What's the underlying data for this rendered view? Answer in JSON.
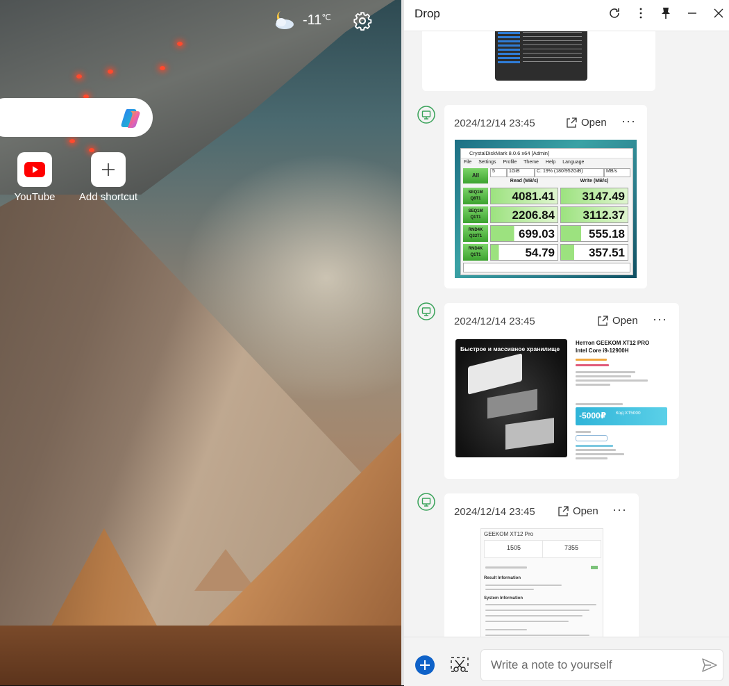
{
  "newtab": {
    "weather": {
      "temperature": "-11",
      "unit": "℃",
      "icon": "partly-cloudy-night-icon"
    },
    "settings_icon": "gear-icon",
    "search": {
      "placeholder": "",
      "copilot_icon": "copilot-icon"
    },
    "shortcuts": [
      {
        "label": "YouTube",
        "icon": "youtube-icon"
      },
      {
        "label": "Add shortcut",
        "icon": "plus-icon"
      }
    ]
  },
  "drop": {
    "title": "Drop",
    "header_icons": [
      "refresh-icon",
      "more-vertical-icon",
      "pin-icon",
      "minimize-icon",
      "close-icon"
    ],
    "items": [
      {
        "timestamp": "2024/12/14 23:45",
        "open_label": "Open",
        "more_label": "···",
        "type": "image",
        "image": {
          "title": "CrystalDiskMark 8.0.6 x64 [Admin]",
          "menu": [
            "File",
            "Settings",
            "Profile",
            "Theme",
            "Help",
            "Language"
          ],
          "all_label": "All",
          "count": "5",
          "size": "1GiB",
          "drive": "C: 19% (180/952GiB)",
          "unit": "MB/s",
          "read_header": "Read (MB/s)",
          "write_header": "Write (MB/s)",
          "rows": [
            {
              "label1": "SEQ1M",
              "label2": "Q8T1",
              "read": "4081.41",
              "write": "3147.49"
            },
            {
              "label1": "SEQ1M",
              "label2": "Q1T1",
              "read": "2206.84",
              "write": "3112.37"
            },
            {
              "label1": "RND4K",
              "label2": "Q32T1",
              "read": "699.03",
              "write": "555.18"
            },
            {
              "label1": "RND4K",
              "label2": "Q1T1",
              "read": "54.79",
              "write": "357.51"
            }
          ]
        }
      },
      {
        "timestamp": "2024/12/14 23:45",
        "open_label": "Open",
        "more_label": "···",
        "type": "image",
        "image": {
          "banner": "Быстрое и массивное хранилище",
          "title_line1": "Неттоп GEEKOM XT12 PRO",
          "title_line2": "Intel Core i9-12900H",
          "promo_price": "-5000₽",
          "promo_code": "Код:XT5000"
        }
      },
      {
        "timestamp": "2024/12/14 23:45",
        "open_label": "Open",
        "more_label": "···",
        "type": "image",
        "image": {
          "title": "GEEKOM XT12 Pro",
          "score_single": "1505",
          "score_multi": "7355",
          "section1": "Result Information",
          "section2": "System Information"
        }
      }
    ],
    "note": {
      "placeholder": "Write a note to yourself",
      "value": ""
    }
  },
  "colors": {
    "accent": "#0f62c8",
    "device_icon": "#3aa35a",
    "cdm_green": "#3ca22f",
    "promo_blue": "#2fb4d8"
  }
}
